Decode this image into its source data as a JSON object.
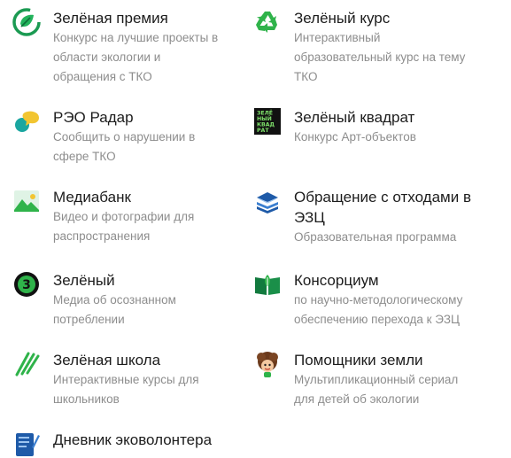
{
  "items": [
    {
      "title": "Зелёная премия",
      "desc": [
        "Конкурс на лучшие проекты в",
        "области экологии и",
        "обращения с ТКО"
      ],
      "icon": "green-prize-leaf-icon"
    },
    {
      "title": "Зелёный курс",
      "desc": [
        "Интерактивный",
        "образовательный курс на тему",
        "ТКО"
      ],
      "icon": "recycle-icon"
    },
    {
      "title": "РЭО Радар",
      "desc": [
        "Сообщить о нарушении в",
        "сфере ТКО"
      ],
      "icon": "radar-bubble-icon"
    },
    {
      "title": "Зелёный квадрат",
      "desc": [
        "Конкурс Арт-объектов"
      ],
      "icon": "green-square-logo-icon",
      "icon_text": [
        "ЗЕЛЁ",
        "НЫЙ",
        "КВАД",
        "РАТ"
      ]
    },
    {
      "title": "Медиабанк",
      "desc": [
        "Видео и фотографии для",
        "распространения"
      ],
      "icon": "image-icon"
    },
    {
      "title_lines": [
        "Обращение с отходами в",
        "ЭЗЦ"
      ],
      "desc": [
        "Образовательная программа"
      ],
      "icon": "book-stack-icon"
    },
    {
      "title": "Зелёный",
      "desc": [
        "Медиа об осознанном",
        "потреблении"
      ],
      "icon": "media-3-icon",
      "icon_text": "3"
    },
    {
      "title": "Консорциум",
      "desc": [
        "по научно-методологическому",
        "обеспечению перехода к ЭЗЦ"
      ],
      "icon": "open-book-icon"
    },
    {
      "title": "Зелёная школа",
      "desc": [
        "Интерактивные курсы для",
        "школьников"
      ],
      "icon": "pencils-icon"
    },
    {
      "title": "Помощники земли",
      "desc": [
        "Мультипликационный сериал",
        "для детей об экологии"
      ],
      "icon": "cartoon-character-icon"
    },
    {
      "title": "Дневник эковолонтера",
      "desc": [],
      "icon": "diary-icon"
    }
  ],
  "colors": {
    "green": "#2fb34a",
    "dark_green": "#127a3e",
    "teal": "#1aa6a0",
    "title": "#1c1c1c",
    "desc": "#8d8d8d"
  }
}
